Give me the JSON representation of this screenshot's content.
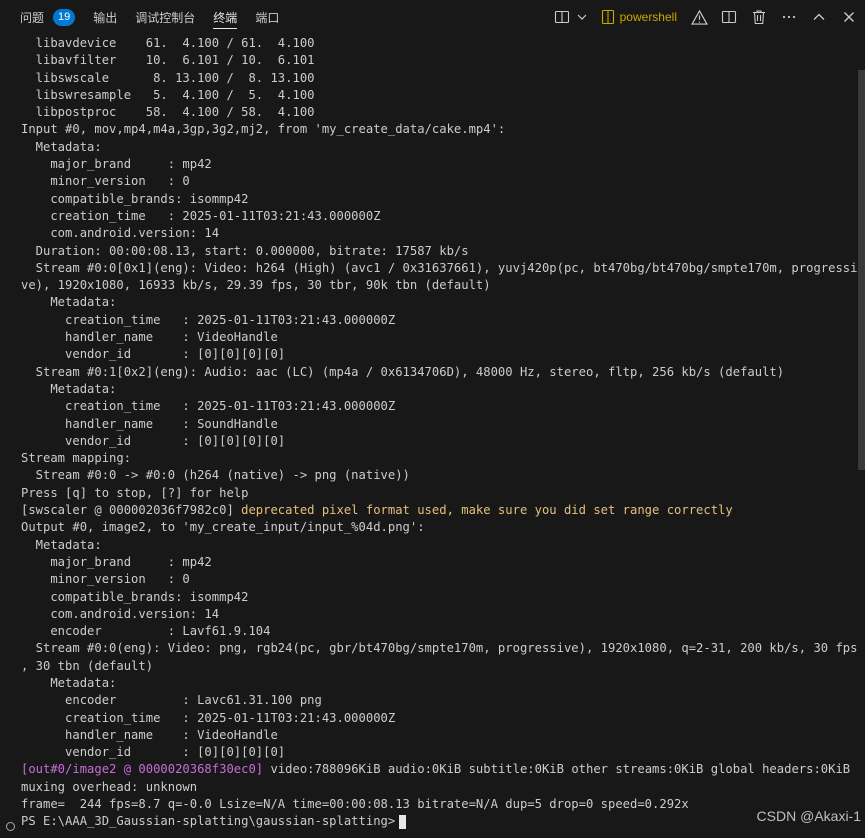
{
  "tabs": [
    {
      "label": "问题",
      "badge": "19"
    },
    {
      "label": "输出"
    },
    {
      "label": "调试控制台"
    },
    {
      "label": "终端"
    },
    {
      "label": "端口"
    }
  ],
  "toolbar": {
    "shell_label": "powershell",
    "icons": [
      "split-layout-icon",
      "chevron-down-icon",
      "warning-icon",
      "split-terminal-icon",
      "trash-icon",
      "more-icon",
      "maximize-chevron-up-icon",
      "close-icon"
    ]
  },
  "terminal": {
    "lines": [
      {
        "text": "  libavdevice    61.  4.100 / 61.  4.100"
      },
      {
        "text": "  libavfilter    10.  6.101 / 10.  6.101"
      },
      {
        "text": "  libswscale      8. 13.100 /  8. 13.100"
      },
      {
        "text": "  libswresample   5.  4.100 /  5.  4.100"
      },
      {
        "text": "  libpostproc    58.  4.100 / 58.  4.100"
      },
      {
        "text": "Input #0, mov,mp4,m4a,3gp,3g2,mj2, from 'my_create_data/cake.mp4':"
      },
      {
        "text": "  Metadata:"
      },
      {
        "text": "    major_brand     : mp42"
      },
      {
        "text": "    minor_version   : 0"
      },
      {
        "text": "    compatible_brands: isommp42"
      },
      {
        "text": "    creation_time   : 2025-01-11T03:21:43.000000Z"
      },
      {
        "text": "    com.android.version: 14"
      },
      {
        "text": "  Duration: 00:00:08.13, start: 0.000000, bitrate: 17587 kb/s"
      },
      {
        "text": "  Stream #0:0[0x1](eng): Video: h264 (High) (avc1 / 0x31637661), yuvj420p(pc, bt470bg/bt470bg/smpte170m, progressi"
      },
      {
        "text": "ve), 1920x1080, 16933 kb/s, 29.39 fps, 30 tbr, 90k tbn (default)"
      },
      {
        "text": "    Metadata:"
      },
      {
        "text": "      creation_time   : 2025-01-11T03:21:43.000000Z"
      },
      {
        "text": "      handler_name    : VideoHandle"
      },
      {
        "text": "      vendor_id       : [0][0][0][0]"
      },
      {
        "text": "  Stream #0:1[0x2](eng): Audio: aac (LC) (mp4a / 0x6134706D), 48000 Hz, stereo, fltp, 256 kb/s (default)"
      },
      {
        "text": "    Metadata:"
      },
      {
        "text": "      creation_time   : 2025-01-11T03:21:43.000000Z"
      },
      {
        "text": "      handler_name    : SoundHandle"
      },
      {
        "text": "      vendor_id       : [0][0][0][0]"
      },
      {
        "text": "Stream mapping:"
      },
      {
        "text": "  Stream #0:0 -> #0:0 (h264 (native) -> png (native))"
      },
      {
        "text": "Press [q] to stop, [?] for help"
      },
      {
        "prefix": "[swscaler @ 000002036f7982c0] ",
        "warn": "deprecated pixel format used, make sure you did set range correctly"
      },
      {
        "text": "Output #0, image2, to 'my_create_input/input_%04d.png':"
      },
      {
        "text": "  Metadata:"
      },
      {
        "text": "    major_brand     : mp42"
      },
      {
        "text": "    minor_version   : 0"
      },
      {
        "text": "    compatible_brands: isommp42"
      },
      {
        "text": "    com.android.version: 14"
      },
      {
        "text": "    encoder         : Lavf61.9.104"
      },
      {
        "text": "  Stream #0:0(eng): Video: png, rgb24(pc, gbr/bt470bg/smpte170m, progressive), 1920x1080, q=2-31, 200 kb/s, 30 fps"
      },
      {
        "text": ", 30 tbn (default)"
      },
      {
        "text": "    Metadata:"
      },
      {
        "text": "      encoder         : Lavc61.31.100 png"
      },
      {
        "text": "      creation_time   : 2025-01-11T03:21:43.000000Z"
      },
      {
        "text": "      handler_name    : VideoHandle"
      },
      {
        "text": "      vendor_id       : [0][0][0][0]"
      },
      {
        "magenta": "[out#0/image2 @ 0000020368f30ec0]",
        "suffix": " video:788096KiB audio:0KiB subtitle:0KiB other streams:0KiB global headers:0KiB"
      },
      {
        "text": "muxing overhead: unknown"
      },
      {
        "text": "frame=  244 fps=8.7 q=-0.0 Lsize=N/A time=00:00:08.13 bitrate=N/A dup=5 drop=0 speed=0.292x"
      }
    ],
    "prompt": "PS E:\\AAA_3D_Gaussian-splatting\\gaussian-splatting>"
  },
  "watermark": "CSDN @Akaxi-1",
  "colors": {
    "background": "#181818",
    "foreground": "#cccccc",
    "warning": "#e5c07b",
    "magenta": "#c66dd8",
    "badge": "#0078d4",
    "shell_accent": "#cca700"
  }
}
